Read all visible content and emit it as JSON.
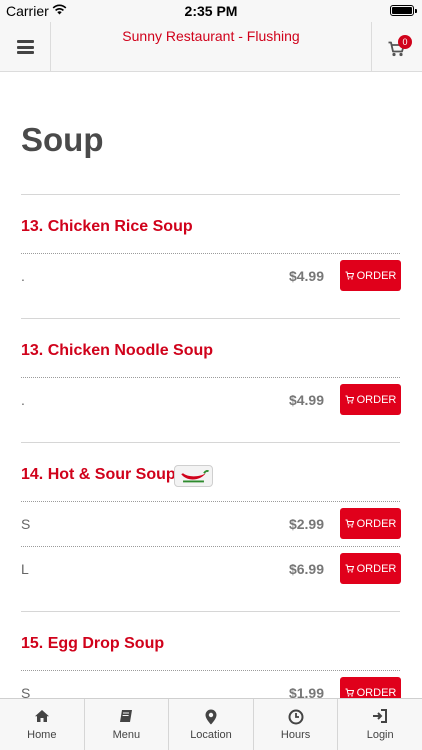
{
  "status_bar": {
    "carrier": "Carrier",
    "time": "2:35 PM"
  },
  "nav": {
    "title": "Sunny Restaurant - Flushing",
    "cart_count": "0"
  },
  "section": {
    "title": "Soup"
  },
  "items": [
    {
      "name": "13. Chicken Rice Soup",
      "options": [
        {
          "label": ".",
          "price": "$4.99",
          "button": "ORDER"
        }
      ]
    },
    {
      "name": "13. Chicken Noodle Soup",
      "options": [
        {
          "label": ".",
          "price": "$4.99",
          "button": "ORDER"
        }
      ]
    },
    {
      "name": "14. Hot & Sour Soup",
      "spicy_icon": "chili-pepper-icon",
      "options": [
        {
          "label": "S",
          "price": "$2.99",
          "button": "ORDER"
        },
        {
          "label": "L",
          "price": "$6.99",
          "button": "ORDER"
        }
      ]
    },
    {
      "name": "15. Egg Drop Soup",
      "options": [
        {
          "label": "S",
          "price": "$1.99",
          "button": "ORDER"
        }
      ]
    }
  ],
  "tabs": [
    {
      "label": "Home",
      "icon": "home-icon"
    },
    {
      "label": "Menu",
      "icon": "book-icon"
    },
    {
      "label": "Location",
      "icon": "map-pin-icon"
    },
    {
      "label": "Hours",
      "icon": "clock-icon"
    },
    {
      "label": "Login",
      "icon": "login-icon"
    }
  ],
  "colors": {
    "accent": "#d0021b",
    "button": "#e0001b",
    "bar_bg": "#f7f7f7"
  }
}
